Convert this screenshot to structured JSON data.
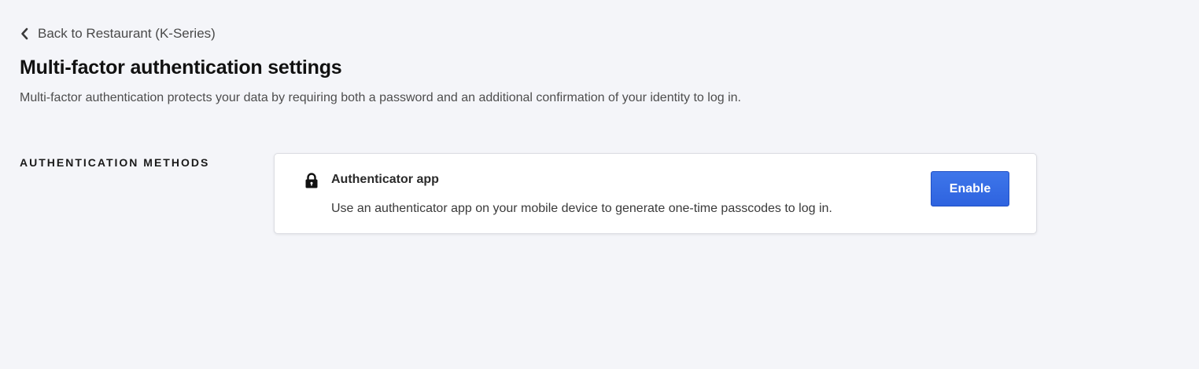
{
  "navigation": {
    "back_label": "Back to Restaurant (K-Series)",
    "back_icon": "chevron-left-icon"
  },
  "header": {
    "title": "Multi-factor authentication settings",
    "subtitle": "Multi-factor authentication protects your data by requiring both a password and an additional confirmation of your identity to log in."
  },
  "section": {
    "label": "AUTHENTICATION METHODS"
  },
  "methods": [
    {
      "icon": "lock-icon",
      "title": "Authenticator app",
      "description": "Use an authenticator app on your mobile device to generate one-time passcodes to log in.",
      "action_label": "Enable"
    }
  ],
  "colors": {
    "background": "#f4f5f9",
    "accent": "#2e63df",
    "card": "#ffffff"
  }
}
